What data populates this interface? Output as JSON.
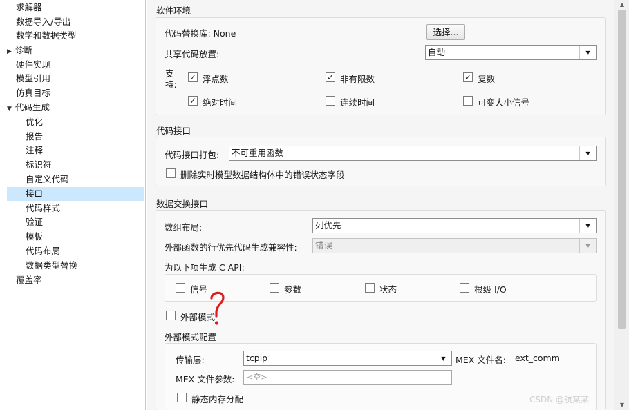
{
  "tree": {
    "items": [
      {
        "label": "求解器"
      },
      {
        "label": "数据导入/导出"
      },
      {
        "label": "数学和数据类型"
      },
      {
        "label": "诊断",
        "arrow": "▶"
      },
      {
        "label": "硬件实现"
      },
      {
        "label": "模型引用"
      },
      {
        "label": "仿真目标"
      },
      {
        "label": "代码生成",
        "arrow": "▼"
      },
      {
        "label": "优化"
      },
      {
        "label": "报告"
      },
      {
        "label": "注释"
      },
      {
        "label": "标识符"
      },
      {
        "label": "自定义代码"
      },
      {
        "label": "接口"
      },
      {
        "label": "代码样式"
      },
      {
        "label": "验证"
      },
      {
        "label": "模板"
      },
      {
        "label": "代码布局"
      },
      {
        "label": "数据类型替换"
      },
      {
        "label": "覆盖率"
      }
    ]
  },
  "software_env": {
    "title": "软件环境",
    "replacement_lib_label": "代码替换库: None",
    "select_button": "选择...",
    "shared_code_label": "共享代码放置:",
    "shared_code_value": "自动",
    "support_label_1": "支",
    "support_label_2": "持:",
    "floating_point": "浮点数",
    "non_finite": "非有限数",
    "complex": "复数",
    "absolute_time": "绝对时间",
    "continuous_time": "连续时间",
    "variable_size": "可变大小信号",
    "check_mark": "✓"
  },
  "code_interface": {
    "title": "代码接口",
    "packaging_label": "代码接口打包:",
    "packaging_value": "不可重用函数",
    "remove_error_status": "删除实时模型数据结构体中的错误状态字段"
  },
  "data_exchange": {
    "title": "数据交换接口",
    "array_layout_label": "数组布局:",
    "array_layout_value": "列优先",
    "row_major_label": "外部函数的行优先代码生成兼容性:",
    "row_major_value": "错误",
    "capi_label": "为以下项生成 C API:",
    "capi_signals": "信号",
    "capi_params": "参数",
    "capi_states": "状态",
    "capi_root_io": "根级 I/O",
    "external_mode": "外部模式",
    "ext_config_title": "外部模式配置",
    "transport_label": "传输层:",
    "transport_value": "tcpip",
    "mex_file_label": "MEX 文件名:",
    "mex_file_value": "ext_comm",
    "mex_args_label": "MEX 文件参数:",
    "mex_args_placeholder": "<空>",
    "static_memory": "静态内存分配"
  },
  "annotation": {
    "text": "?",
    "color": "#d81e1e"
  },
  "watermark": "CSDN @航某某",
  "colors": {
    "selection": "#cce8ff",
    "accent_annotation": "#d81e1e"
  }
}
